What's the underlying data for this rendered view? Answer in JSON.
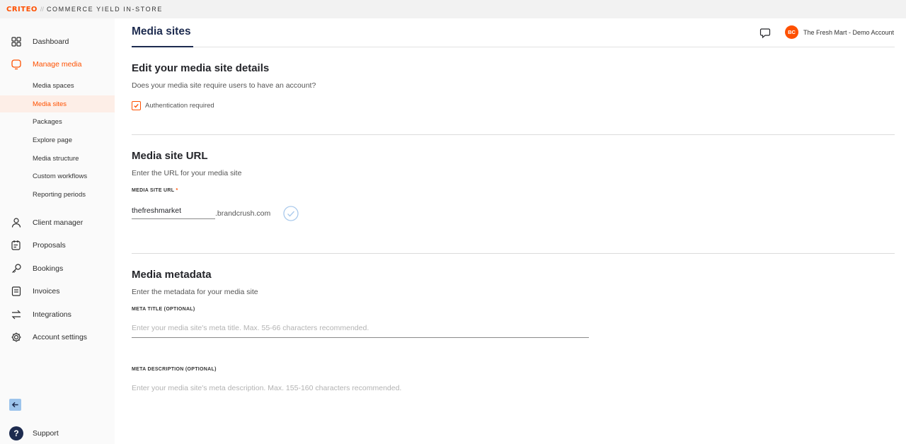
{
  "brand": {
    "logo": "CRITEO",
    "separator": "//",
    "product": "COMMERCE YIELD IN-STORE",
    "accent_color": "#fe5000",
    "navy_color": "#1d2b4f"
  },
  "sidebar": {
    "items": [
      {
        "label": "Dashboard",
        "icon": "grid-icon"
      },
      {
        "label": "Manage media",
        "icon": "monitor-icon"
      },
      {
        "label": "Client manager",
        "icon": "user-icon"
      },
      {
        "label": "Proposals",
        "icon": "document-edit-icon"
      },
      {
        "label": "Bookings",
        "icon": "key-icon"
      },
      {
        "label": "Invoices",
        "icon": "receipt-icon"
      },
      {
        "label": "Integrations",
        "icon": "arrows-swap-icon"
      },
      {
        "label": "Account settings",
        "icon": "gear-icon"
      }
    ],
    "sub_items": [
      {
        "label": "Media spaces"
      },
      {
        "label": "Media sites"
      },
      {
        "label": "Packages"
      },
      {
        "label": "Explore page"
      },
      {
        "label": "Media structure"
      },
      {
        "label": "Custom workflows"
      },
      {
        "label": "Reporting periods"
      }
    ],
    "support_label": "Support",
    "support_glyph": "?"
  },
  "header": {
    "title": "Media sites",
    "avatar_initials": "BC",
    "account_name": "The Fresh Mart - Demo Account"
  },
  "details_section": {
    "title": "Edit your media site details",
    "subtitle": "Does your media site require users to have an account?",
    "checkbox_label": "Authentication required",
    "checkbox_checked": true
  },
  "url_section": {
    "title": "Media site URL",
    "subtitle": "Enter the URL for your media site",
    "field_label": "MEDIA SITE URL",
    "required_mark": "*",
    "value": "thefreshmarket",
    "suffix": ".brandcrush.com"
  },
  "metadata_section": {
    "title": "Media metadata",
    "subtitle": "Enter the metadata for your media site",
    "meta_title_label": "META TITLE (OPTIONAL)",
    "meta_title_placeholder": "Enter your media site's meta title. Max. 55-66 characters recommended.",
    "meta_title_value": "",
    "meta_desc_label": "META DESCRIPTION (OPTIONAL)",
    "meta_desc_placeholder": "Enter your media site's meta description. Max. 155-160 characters recommended.",
    "meta_desc_value": ""
  }
}
